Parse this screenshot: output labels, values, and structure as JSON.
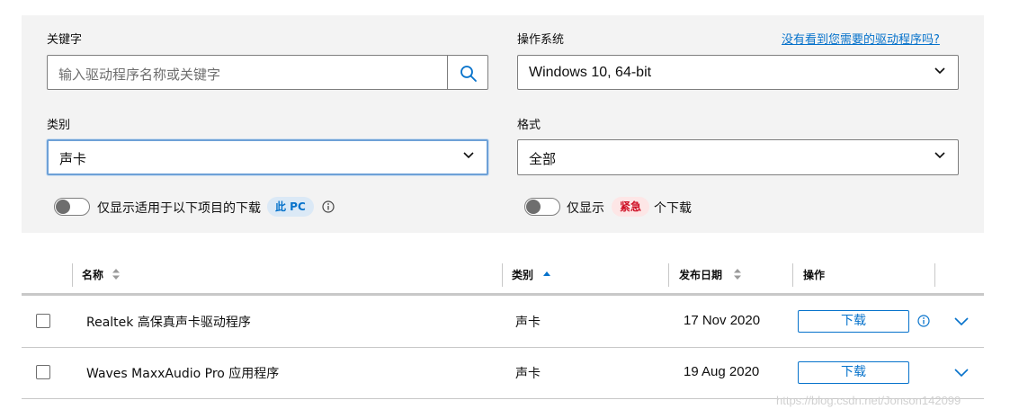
{
  "filters": {
    "keyword": {
      "label": "关键字",
      "placeholder": "输入驱动程序名称或关键字"
    },
    "os": {
      "label": "操作系统",
      "value": "Windows 10, 64-bit"
    },
    "help_link": "没有看到您需要的驱动程序吗?",
    "category": {
      "label": "类别",
      "value": "声卡"
    },
    "format": {
      "label": "格式",
      "value": "全部"
    },
    "toggle_pc": {
      "text": "仅显示适用于以下项目的下载",
      "badge": "此 PC"
    },
    "toggle_urgent": {
      "prefix": "仅显示",
      "badge": "紧急",
      "suffix": "个下载"
    }
  },
  "table": {
    "columns": {
      "name": "名称",
      "category": "类别",
      "date": "发布日期",
      "action": "操作"
    },
    "rows": [
      {
        "name": "Realtek 高保真声卡驱动程序",
        "category": "声卡",
        "date": "17 Nov 2020",
        "action": "下载"
      },
      {
        "name": "Waves MaxxAudio Pro 应用程序",
        "category": "声卡",
        "date": "19 Aug 2020",
        "action": "下载"
      }
    ]
  },
  "watermark": "https://blog.csdn.net/Jonson142099",
  "colors": {
    "accent": "#0672cb",
    "panel": "#f3f3f3",
    "urgent": "#ce1126"
  }
}
